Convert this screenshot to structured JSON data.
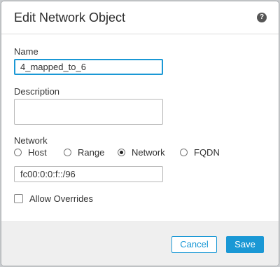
{
  "dialog": {
    "title": "Edit Network Object",
    "help_icon": "help-icon",
    "help_glyph": "?"
  },
  "form": {
    "name_label": "Name",
    "name_value": "4_mapped_to_6",
    "description_label": "Description",
    "description_value": "",
    "network_label": "Network",
    "network_types": [
      {
        "label": "Host",
        "selected": false
      },
      {
        "label": "Range",
        "selected": false
      },
      {
        "label": "Network",
        "selected": true
      },
      {
        "label": "FQDN",
        "selected": false
      }
    ],
    "network_value": "fc00:0:0:f::/96",
    "allow_overrides_label": "Allow Overrides",
    "allow_overrides_checked": false
  },
  "footer": {
    "cancel_label": "Cancel",
    "save_label": "Save"
  },
  "colors": {
    "accent": "#1a98d5",
    "footer_bg": "#efefef"
  }
}
